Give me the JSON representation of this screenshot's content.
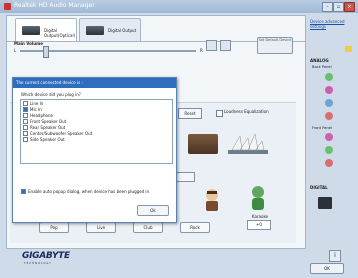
{
  "window": {
    "title": "Realtek HD Audio Manager",
    "controls": {
      "minimize": "–",
      "restore": "▫",
      "close": "×"
    }
  },
  "tabs": [
    {
      "label": "Digital Output(Optical)",
      "active": true
    },
    {
      "label": "Digital Output",
      "active": false
    }
  ],
  "volume": {
    "title": "Main Volume",
    "left_label": "L",
    "right_label": "R",
    "level_fraction": 0.14,
    "set_default_label": "Set Default Device"
  },
  "effects": {
    "reset_label": "Reset",
    "loudness_label": "Loudness Equalization",
    "karaoke_label": "Karaoke",
    "karaoke_value": "+0",
    "bottom_buttons": [
      "Pop",
      "Live",
      "Club",
      "Rock"
    ]
  },
  "side": {
    "advanced_link": "Device advanced settings",
    "analog_title": "ANALOG",
    "back_panel": "Back Panel",
    "front_panel": "Front Panel",
    "digital_title": "DIGITAL",
    "colors": {
      "back": [
        "#6ac06d",
        "#d05fae",
        "#6fa4d2",
        "#d86e6e"
      ],
      "front": [
        "#d05fae",
        "#6ac06d",
        "#d86e6e"
      ]
    }
  },
  "brand": {
    "name": "GIGABYTE",
    "tagline": "TECHNOLOGY"
  },
  "footer": {
    "info_label": "i",
    "ok_label": "OK"
  },
  "dialog": {
    "title": "The current connected device is :",
    "question": "Which device did you plug in?",
    "options": [
      {
        "label": "Line In",
        "checked": false
      },
      {
        "label": "Mic In",
        "checked": true
      },
      {
        "label": "Headphone",
        "checked": false
      },
      {
        "label": "Front Speaker Out",
        "checked": false
      },
      {
        "label": "Rear Speaker Out",
        "checked": false
      },
      {
        "label": "Center/Subwoofer Speaker Out",
        "checked": false
      },
      {
        "label": "Side Speaker Out",
        "checked": false
      }
    ],
    "auto_popup_label": "Enable auto popup dialog, when device has been plugged in",
    "auto_popup_checked": true,
    "ok_label": "Ok"
  },
  "accent_color": "#2f6ebf"
}
